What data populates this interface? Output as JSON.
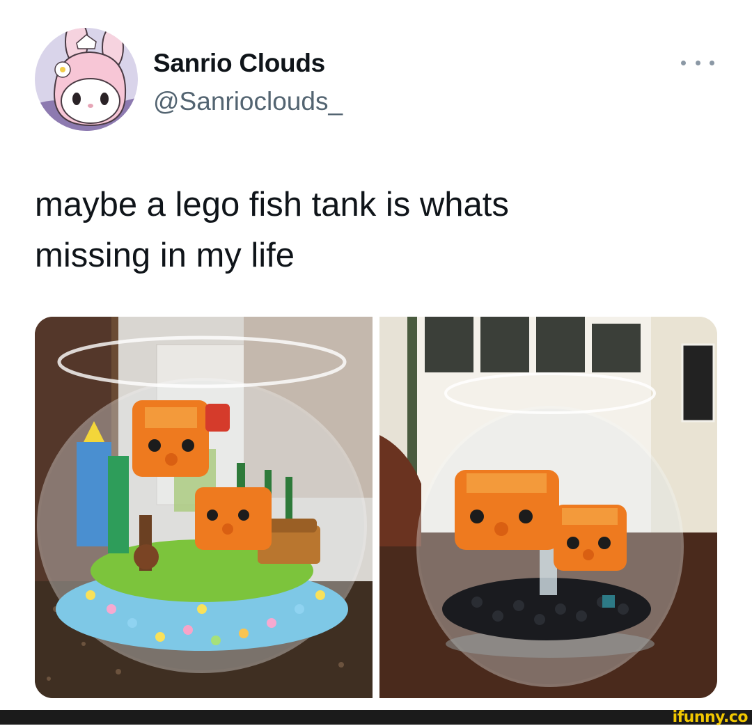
{
  "tweet": {
    "display_name": "Sanrio Clouds",
    "handle": "@Sanrioclouds_",
    "text": "maybe a lego fish tank is whats\nmissing in my life",
    "more_icon": "more-horizontal-icon"
  },
  "media": {
    "photos": [
      {
        "subject": "round glass fish bowl with lego goldfish, plants and colourful studs on granite counter"
      },
      {
        "subject": "round glass fish bowl with two lego goldfish on black studs on wooden table"
      }
    ]
  },
  "watermark": {
    "text": "ifunny.co"
  },
  "colors": {
    "name": "#0f1419",
    "handle": "#536471",
    "accent_orange": "#ee7a1f",
    "watermark": "#f2c800"
  }
}
